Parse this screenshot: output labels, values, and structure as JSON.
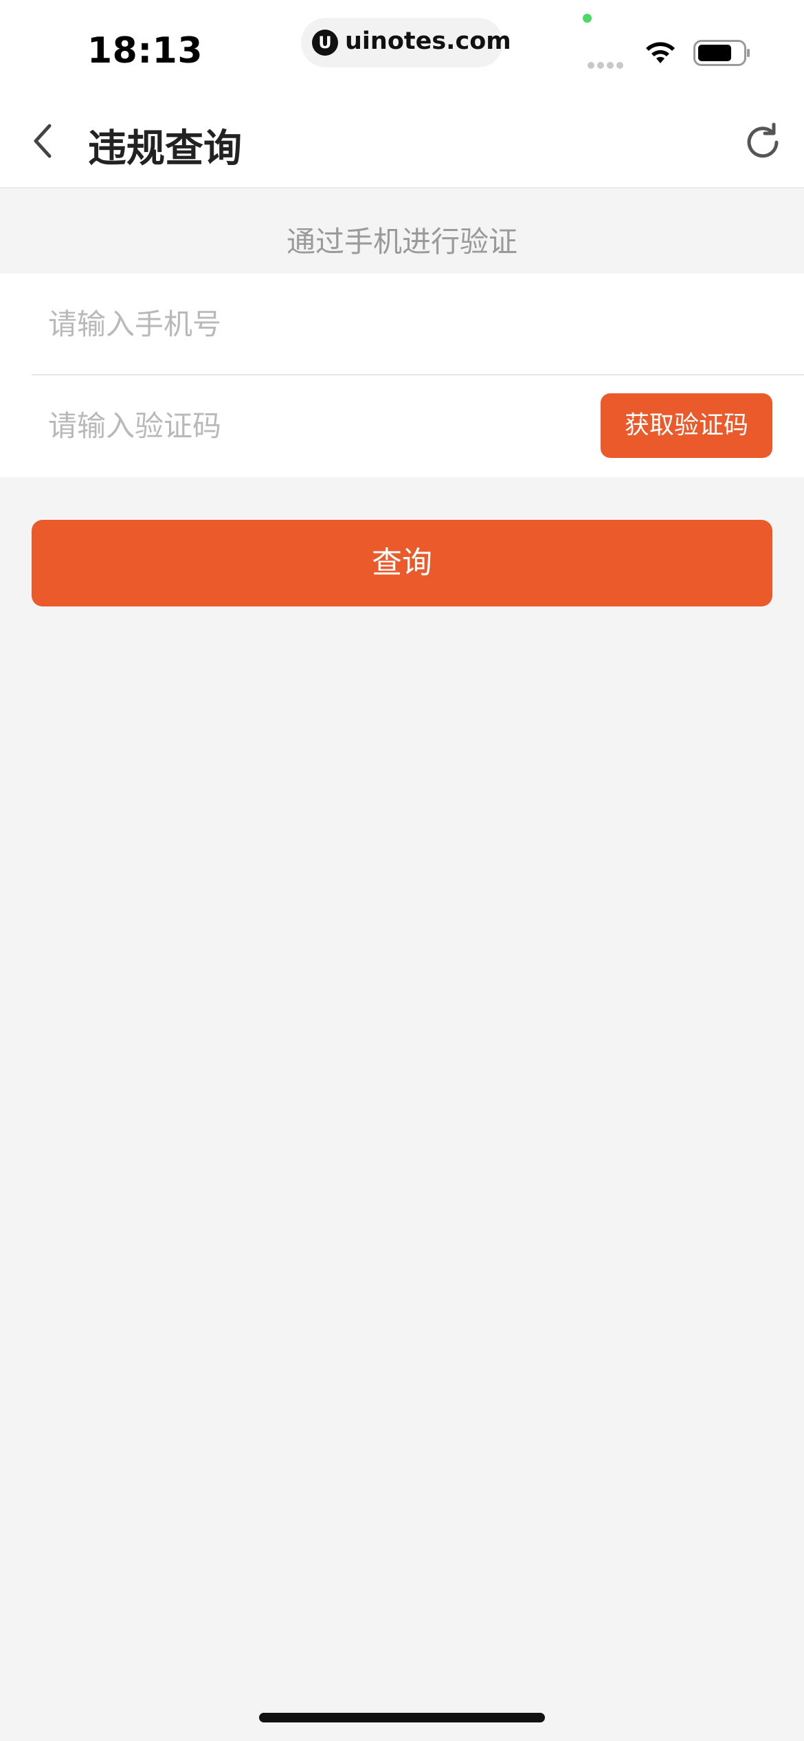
{
  "status_bar": {
    "time": "18:13",
    "url": "uinotes.com",
    "logo_letter": "U",
    "icons": [
      "green-dot",
      "signal-icon",
      "wifi-icon",
      "battery-icon"
    ]
  },
  "nav": {
    "title": "违规查询",
    "back_icon": "chevron-left-icon",
    "refresh_icon": "refresh-icon"
  },
  "form": {
    "section_title": "通过手机进行验证",
    "phone_placeholder": "请输入手机号",
    "phone_value": "",
    "code_placeholder": "请输入验证码",
    "code_value": "",
    "get_code_label": "获取验证码"
  },
  "actions": {
    "query_label": "查询"
  },
  "colors": {
    "accent": "#ea5a2a",
    "background": "#f4f4f4",
    "surface": "#ffffff",
    "placeholder": "#b9b9b9"
  }
}
